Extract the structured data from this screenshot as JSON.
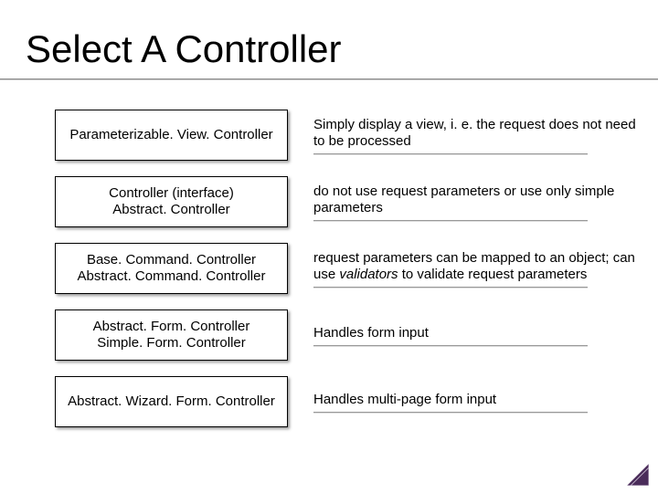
{
  "title": "Select A Controller",
  "rows": [
    {
      "box": [
        "Parameterizable. View. Controller"
      ],
      "desc": "Simply display a view, i. e. the request does not need to be processed"
    },
    {
      "box": [
        "Controller (interface)",
        "Abstract. Controller"
      ],
      "desc": "do not use request parameters or use only simple parameters"
    },
    {
      "box": [
        "Base. Command. Controller",
        "Abstract. Command. Controller"
      ],
      "desc_html": "request parameters can be mapped to an object; can use <em>validators</em> to validate request parameters"
    },
    {
      "box": [
        "Abstract. Form. Controller",
        "Simple. Form. Controller"
      ],
      "desc": "Handles form input"
    },
    {
      "box": [
        "Abstract. Wizard. Form. Controller"
      ],
      "desc": "Handles multi-page form input"
    }
  ]
}
